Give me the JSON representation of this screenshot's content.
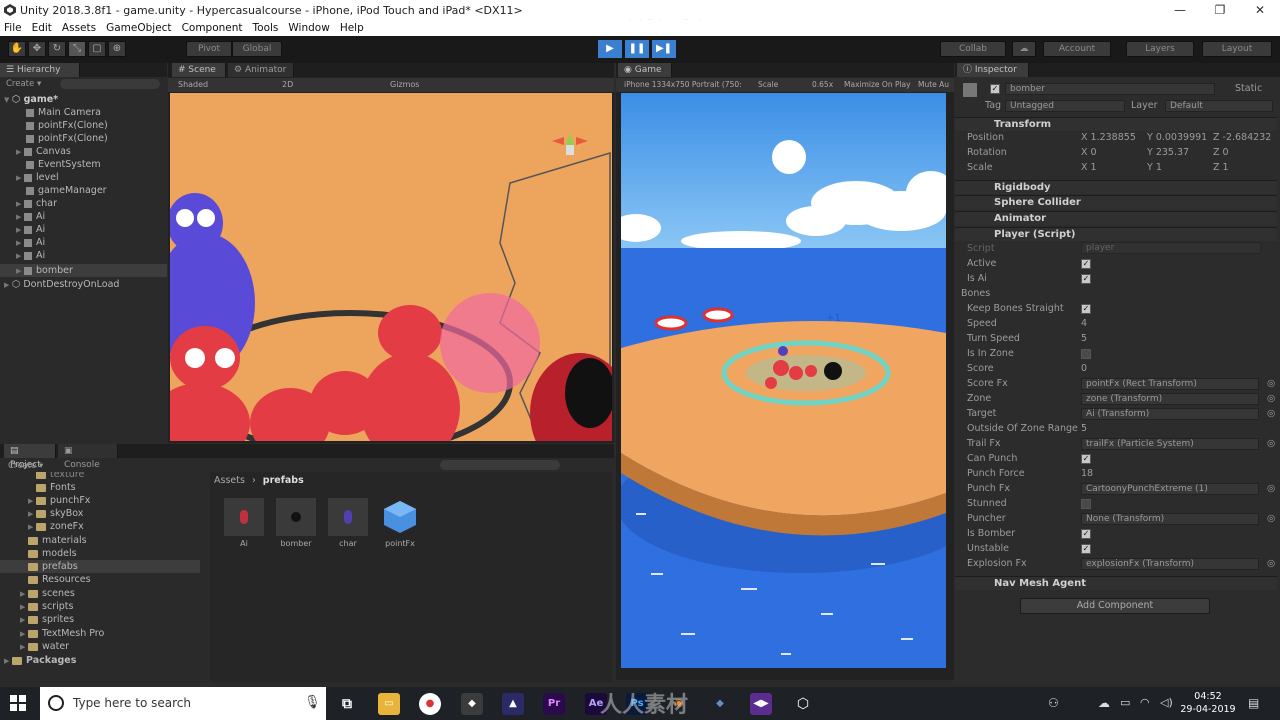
{
  "window": {
    "title": "Unity 2018.3.8f1 - game.unity - Hypercasualcourse - iPhone, iPod Touch and iPad* <DX11>",
    "watermark": "www.rrcg.cn",
    "minimize": "—",
    "maximize": "❐",
    "close": "✕"
  },
  "menu": [
    "File",
    "Edit",
    "Assets",
    "GameObject",
    "Component",
    "Tools",
    "Window",
    "Help"
  ],
  "toolbar": {
    "pivot": "Pivot",
    "global": "Global",
    "collab": "Collab",
    "account": "Account",
    "layers": "Layers",
    "layout": "Layout"
  },
  "hierarchy": {
    "tab": "Hierarchy",
    "create": "Create",
    "scene": "game*",
    "items": [
      "Main Camera",
      "pointFx(Clone)",
      "pointFx(Clone)",
      "Canvas",
      "EventSystem",
      "level",
      "gameManager",
      "char",
      "Ai",
      "Ai",
      "Ai",
      "Ai",
      "bomber"
    ],
    "dontdestroy": "DontDestroyOnLoad"
  },
  "scene_view": {
    "tab_scene": "Scene",
    "tab_animator": "Animator",
    "shaded": "Shaded",
    "mode_2d": "2D",
    "gizmos": "Gizmos"
  },
  "game_view": {
    "tab": "Game",
    "resolution": "iPhone 1334x750 Portrait (750:",
    "scale_label": "Scale",
    "scale_value": "0.65x",
    "maximize": "Maximize On Play",
    "mute": "Mute Au",
    "score_popup": "+1"
  },
  "project": {
    "tab_project": "Project",
    "tab_console": "Console",
    "create": "Create",
    "tree": [
      {
        "label": "texture",
        "depth": 3
      },
      {
        "label": "Fonts",
        "depth": 3
      },
      {
        "label": "punchFx",
        "depth": 3
      },
      {
        "label": "skyBox",
        "depth": 3
      },
      {
        "label": "zoneFx",
        "depth": 3
      },
      {
        "label": "materials",
        "depth": 2
      },
      {
        "label": "models",
        "depth": 2
      },
      {
        "label": "prefabs",
        "depth": 2
      },
      {
        "label": "Resources",
        "depth": 2
      },
      {
        "label": "scenes",
        "depth": 2
      },
      {
        "label": "scripts",
        "depth": 2
      },
      {
        "label": "sprites",
        "depth": 2
      },
      {
        "label": "TextMesh Pro",
        "depth": 2
      },
      {
        "label": "water",
        "depth": 2
      },
      {
        "label": "Packages",
        "depth": 1
      }
    ],
    "breadcrumb_root": "Assets",
    "breadcrumb_sep": "›",
    "breadcrumb_current": "prefabs",
    "assets": [
      {
        "name": "Ai",
        "color": "#c03040"
      },
      {
        "name": "bomber",
        "color": "#303030"
      },
      {
        "name": "char",
        "color": "#5040b0"
      },
      {
        "name": "pointFx",
        "color": "#4a90e0"
      }
    ]
  },
  "inspector": {
    "tab": "Inspector",
    "object_name": "bomber",
    "static": "Static",
    "tag_label": "Tag",
    "tag_value": "Untagged",
    "layer_label": "Layer",
    "layer_value": "Default",
    "transform": {
      "title": "Transform",
      "position_label": "Position",
      "rotation_label": "Rotation",
      "scale_label": "Scale",
      "position": {
        "x": "1.238855",
        "y": "0.0039991",
        "z": "-2.684232"
      },
      "rotation": {
        "x": "0",
        "y": "235.37",
        "z": "0"
      },
      "scale": {
        "x": "1",
        "y": "1",
        "z": "1"
      }
    },
    "components": [
      "Rigidbody",
      "Sphere Collider",
      "Animator",
      "Player (Script)"
    ],
    "player_script": {
      "script_label": "Script",
      "script_value": "player",
      "fields": [
        {
          "label": "Active",
          "type": "check",
          "value": true
        },
        {
          "label": "Is Ai",
          "type": "check",
          "value": true
        },
        {
          "label": "Bones",
          "type": "fold"
        },
        {
          "label": "Keep Bones Straight",
          "type": "check",
          "value": true
        },
        {
          "label": "Speed",
          "type": "num",
          "value": "4"
        },
        {
          "label": "Turn Speed",
          "type": "num",
          "value": "5"
        },
        {
          "label": "Is In Zone",
          "type": "check",
          "value": false
        },
        {
          "label": "Score",
          "type": "num",
          "value": "0"
        },
        {
          "label": "Score Fx",
          "type": "ref",
          "value": "pointFx (Rect Transform)"
        },
        {
          "label": "Zone",
          "type": "ref",
          "value": "zone (Transform)"
        },
        {
          "label": "Target",
          "type": "ref",
          "value": "Ai (Transform)"
        },
        {
          "label": "Outside Of Zone Range",
          "type": "num",
          "value": "5"
        },
        {
          "label": "Trail Fx",
          "type": "ref",
          "value": "trailFx (Particle System)"
        },
        {
          "label": "Can Punch",
          "type": "check",
          "value": true
        },
        {
          "label": "Punch Force",
          "type": "num",
          "value": "18"
        },
        {
          "label": "Punch Fx",
          "type": "ref",
          "value": "CartoonyPunchExtreme (1)"
        },
        {
          "label": "Stunned",
          "type": "check",
          "value": false
        },
        {
          "label": "Puncher",
          "type": "ref",
          "value": "None (Transform)"
        },
        {
          "label": "Is Bomber",
          "type": "check",
          "value": true
        },
        {
          "label": "Unstable",
          "type": "check",
          "value": true
        },
        {
          "label": "Explosion Fx",
          "type": "ref",
          "value": "explosionFx (Transform)"
        }
      ]
    },
    "nav_mesh": "Nav Mesh Agent",
    "add_component": "Add Component"
  },
  "taskbar": {
    "search_placeholder": "Type here to search",
    "time": "04:52",
    "date": "29-04-2019",
    "watermark": "人人素材"
  },
  "colors": {
    "unity_blue": "#3b7fd1",
    "scene_bg": "#f0a860",
    "sky": "#4aa0e8",
    "sea": "#2f6fe0",
    "island": "#f0a560"
  }
}
